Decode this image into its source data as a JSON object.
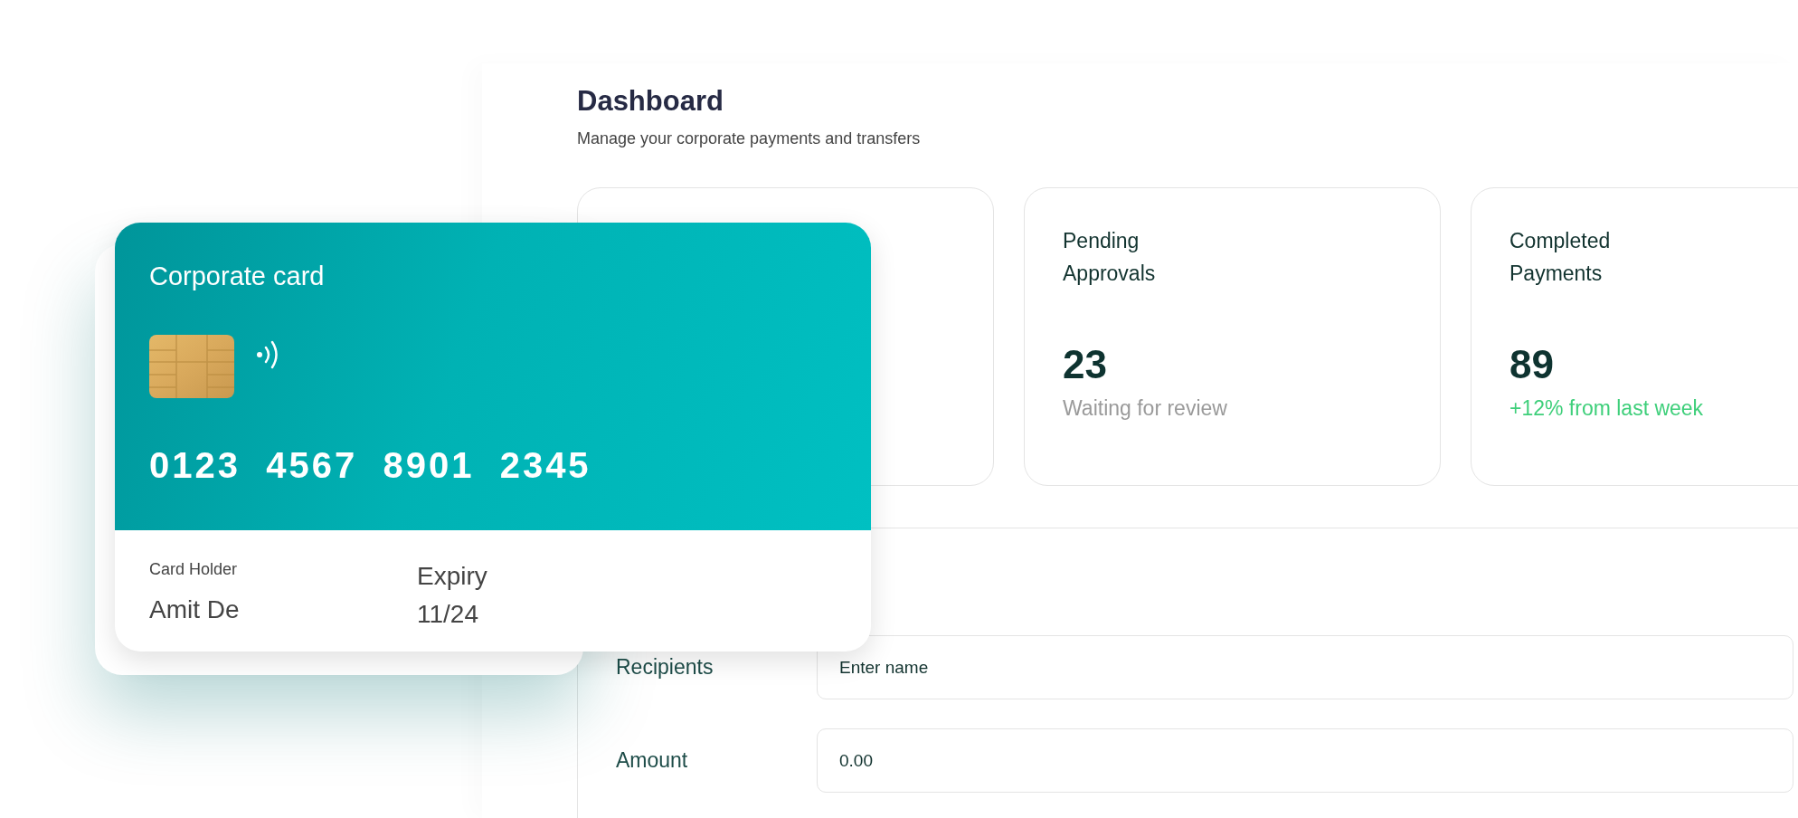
{
  "header": {
    "title": "Dashboard",
    "subtitle": "Manage your corporate payments and transfers"
  },
  "stats": [
    {
      "title": "Pending\nApprovals",
      "value": "23",
      "note": "Waiting for review",
      "kind": "neutral"
    },
    {
      "title": "Completed\nPayments",
      "value": "89",
      "note": "+12% from last week",
      "kind": "positive"
    }
  ],
  "form": {
    "fields": [
      {
        "label": "Recipients",
        "placeholder": "Enter name"
      },
      {
        "label": "Amount",
        "placeholder": "0.00"
      }
    ]
  },
  "card": {
    "label": "Corporate card",
    "number": "0123  4567  8901  2345",
    "holder_label": "Card Holder",
    "holder": "Amit De",
    "expiry_label": "Expiry",
    "expiry": "11/24"
  }
}
